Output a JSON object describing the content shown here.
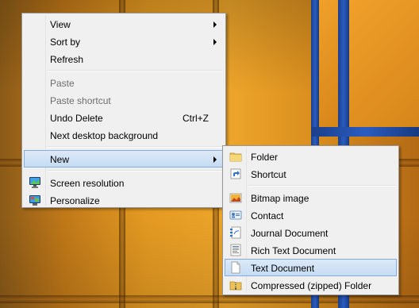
{
  "desktop_menu": {
    "items": [
      {
        "label": "View",
        "submenu": true,
        "disabled": false
      },
      {
        "label": "Sort by",
        "submenu": true,
        "disabled": false
      },
      {
        "label": "Refresh",
        "disabled": false
      },
      {
        "label": "Paste",
        "disabled": true
      },
      {
        "label": "Paste shortcut",
        "disabled": true
      },
      {
        "label": "Undo Delete",
        "shortcut": "Ctrl+Z",
        "disabled": false
      },
      {
        "label": "Next desktop background",
        "disabled": false
      },
      {
        "label": "New",
        "submenu": true,
        "highlighted": true
      },
      {
        "label": "Screen resolution",
        "icon": "monitor-icon"
      },
      {
        "label": "Personalize",
        "icon": "personalize-icon"
      }
    ]
  },
  "new_submenu": {
    "items": [
      {
        "label": "Folder",
        "icon": "folder-icon"
      },
      {
        "label": "Shortcut",
        "icon": "shortcut-icon"
      },
      {
        "label": "Bitmap image",
        "icon": "bitmap-icon"
      },
      {
        "label": "Contact",
        "icon": "contact-icon"
      },
      {
        "label": "Journal Document",
        "icon": "journal-icon"
      },
      {
        "label": "Rich Text Document",
        "icon": "rich-text-icon"
      },
      {
        "label": "Text Document",
        "icon": "text-document-icon",
        "highlighted": true
      },
      {
        "label": "Compressed (zipped) Folder",
        "icon": "zip-folder-icon"
      }
    ]
  },
  "colors": {
    "menu_bg": "#f0f0f0",
    "highlight": "#c5dcf4",
    "highlight_border": "#84acdd",
    "disabled_text": "#6d6d6d",
    "wallpaper_orange": "#e49a22",
    "window_blue": "#2a5cc0"
  }
}
